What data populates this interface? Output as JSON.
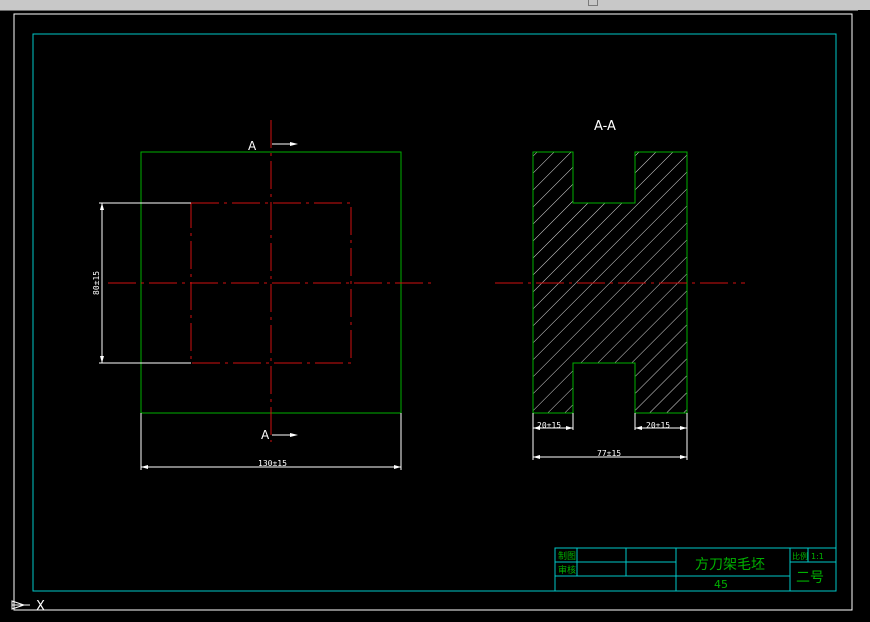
{
  "view_labels": {
    "section_marker_top": "A",
    "section_marker_bottom": "A",
    "section_view_title": "A-A"
  },
  "dimensions": {
    "front_height": "80±15",
    "front_width": "130±15",
    "section_left_slot": "20±15",
    "section_right_slot": "20±15",
    "section_width": "77±15"
  },
  "title_block": {
    "drawn_label": "制图",
    "checked_label": "审核",
    "part_name": "方刀架毛坯",
    "material": "45",
    "scale_label": "比例",
    "scale_value": "1:1",
    "sheet": "二号"
  },
  "ucs_icon": {
    "x_label": "X"
  },
  "colors": {
    "background": "#000000",
    "border": "#00c8c8",
    "outline": "#00b000",
    "centerline": "#d01010",
    "dimension": "#ffffff",
    "hatch": "#e0e0e0"
  }
}
